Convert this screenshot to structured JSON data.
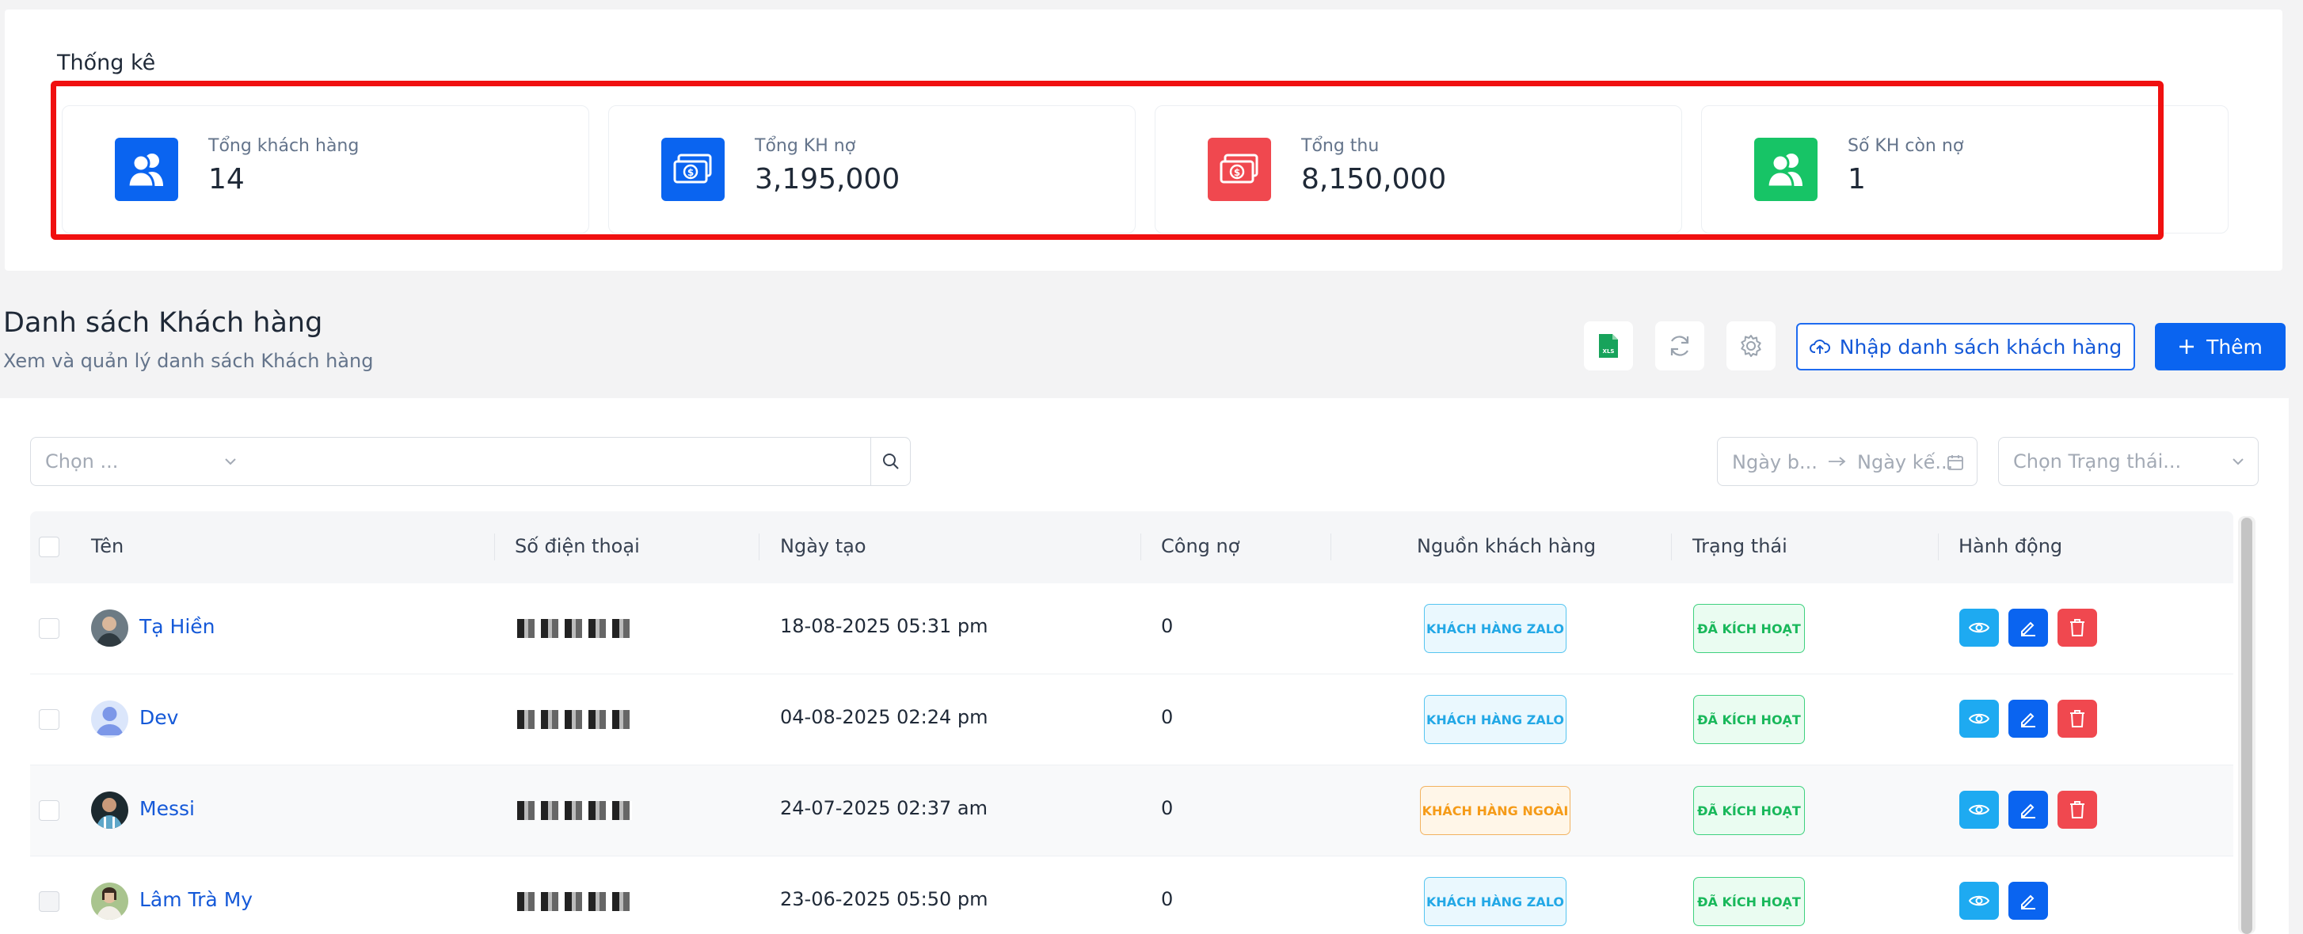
{
  "stats": {
    "title": "Thống kê",
    "cards": [
      {
        "label": "Tổng khách hàng",
        "value": "14",
        "icon": "users-icon",
        "color": "#0a64f0"
      },
      {
        "label": "Tổng KH nợ",
        "value": "3,195,000",
        "icon": "money-icon",
        "color": "#0a64f0"
      },
      {
        "label": "Tổng thu",
        "value": "8,150,000",
        "icon": "money-icon",
        "color": "#f0484f"
      },
      {
        "label": "Số KH còn nợ",
        "value": "1",
        "icon": "users-icon",
        "color": "#17c466"
      }
    ]
  },
  "list": {
    "title": "Danh sách Khách hàng",
    "subtitle": "Xem và quản lý danh sách Khách hàng"
  },
  "toolbar": {
    "excel_icon_text": "XLS",
    "import_label": "Nhập danh sách khách hàng",
    "add_label": "Thêm"
  },
  "filters": {
    "select_placeholder": "Chọn ...",
    "date_start_placeholder": "Ngày b...",
    "date_end_placeholder": "Ngày kế...",
    "status_placeholder": "Chọn Trạng thái..."
  },
  "table": {
    "columns": [
      "Tên",
      "Số điện thoại",
      "Ngày tạo",
      "Công nợ",
      "Nguồn khách hàng",
      "Trạng thái",
      "Hành động"
    ],
    "rows": [
      {
        "name": "Tạ Hiền",
        "created": "18-08-2025 05:31 pm",
        "debt": "0",
        "source": "KHÁCH HÀNG ZALO",
        "status": "ĐÃ KÍCH HOẠT",
        "can_delete": true
      },
      {
        "name": "Dev",
        "created": "04-08-2025 02:24 pm",
        "debt": "0",
        "source": "KHÁCH HÀNG ZALO",
        "status": "ĐÃ KÍCH HOẠT",
        "can_delete": true
      },
      {
        "name": "Messi",
        "created": "24-07-2025 02:37 am",
        "debt": "0",
        "source": "KHÁCH HÀNG NGOÀI",
        "status": "ĐÃ KÍCH HOẠT",
        "can_delete": true
      },
      {
        "name": "Lâm Trà My",
        "created": "23-06-2025 05:50 pm",
        "debt": "0",
        "source": "KHÁCH HÀNG ZALO",
        "status": "ĐÃ KÍCH HOẠT",
        "can_delete": false
      }
    ]
  }
}
